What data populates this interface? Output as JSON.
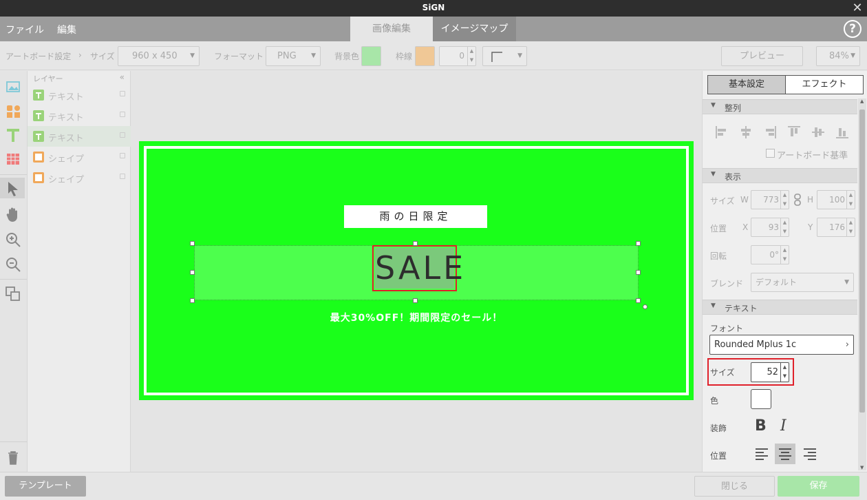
{
  "window": {
    "title": "SiGN",
    "close_glyph": "✕"
  },
  "menu": {
    "file": "ファイル",
    "edit": "編集"
  },
  "mode_tabs": [
    {
      "label": "画像編集",
      "active": true
    },
    {
      "label": "イメージマップ",
      "active": false
    }
  ],
  "help": {
    "glyph": "?"
  },
  "toolbar": {
    "artboard_label": "アートボード設定",
    "separator": "›",
    "size_label": "サイズ",
    "size_value": "960 x 450",
    "format_label": "フォーマット",
    "format_value": "PNG",
    "bg_label": "背景色",
    "bg_color": "#a8e6a8",
    "border_label": "枠線",
    "border_color": "#f0c896",
    "border_width": "0",
    "preview": "プレビュー",
    "zoom": "84%"
  },
  "layers": {
    "header": "レイヤー",
    "collapse": "«",
    "items": [
      {
        "type": "text",
        "name": "テキスト"
      },
      {
        "type": "text",
        "name": "テキスト"
      },
      {
        "type": "text",
        "name": "テキスト",
        "selected": true
      },
      {
        "type": "shape",
        "name": "シェイプ"
      },
      {
        "type": "shape",
        "name": "シェイプ"
      }
    ]
  },
  "canvas": {
    "rain_label": "雨の日限定",
    "sale_text": "SALE",
    "sub_text": "最大30%OFF！期間限定のセール！",
    "artboard_color": "#1aff1a"
  },
  "panel": {
    "tabs": {
      "basic": "基本設定",
      "effect": "エフェクト"
    },
    "align": {
      "title": "整列",
      "artboard_basis": "アートボード基準"
    },
    "display": {
      "title": "表示",
      "size_label": "サイズ",
      "w_label": "W",
      "w_value": "773",
      "h_label": "H",
      "h_value": "100",
      "position_label": "位置",
      "x_label": "X",
      "x_value": "93",
      "y_label": "Y",
      "y_value": "176",
      "rotation_label": "回転",
      "rotation_value": "0°",
      "blend_label": "ブレンド",
      "blend_value": "デフォルト"
    },
    "text": {
      "title": "テキスト",
      "font_label": "フォント",
      "font_value": "Rounded Mplus 1c",
      "size_label": "サイズ",
      "size_value": "52",
      "color_label": "色",
      "color_value": "#ffffff",
      "decoration_label": "装飾",
      "bold": "B",
      "italic": "I",
      "position_label": "位置"
    }
  },
  "footer": {
    "template": "テンプレート",
    "close": "閉じる",
    "save": "保存"
  }
}
